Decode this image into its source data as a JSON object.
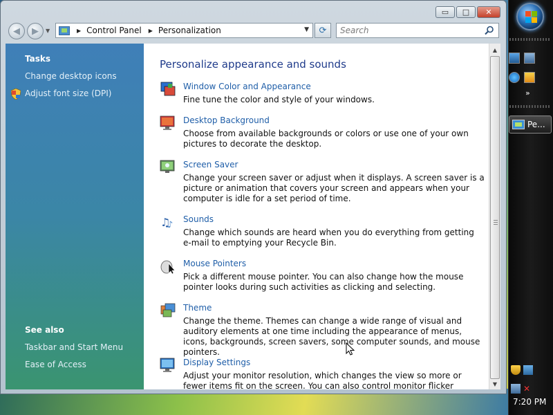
{
  "address": {
    "crumbs": [
      "Control Panel",
      "Personalization"
    ]
  },
  "search": {
    "placeholder": "Search"
  },
  "window_buttons": {
    "minimize": "▭",
    "maximize": "□",
    "close": "✕"
  },
  "left_pane": {
    "tasks_heading": "Tasks",
    "tasks": [
      "Change desktop icons",
      "Adjust font size (DPI)"
    ],
    "see_also_heading": "See also",
    "see_also": [
      "Taskbar and Start Menu",
      "Ease of Access"
    ]
  },
  "content": {
    "title": "Personalize appearance and sounds",
    "items": [
      {
        "label": "Window Color and Appearance",
        "desc": "Fine tune the color and style of your windows.",
        "icon": "window-color-icon"
      },
      {
        "label": "Desktop Background",
        "desc": "Choose from available backgrounds or colors or use one of your own pictures to decorate the desktop.",
        "icon": "desktop-background-icon"
      },
      {
        "label": "Screen Saver",
        "desc": "Change your screen saver or adjust when it displays. A screen saver is a picture or animation that covers your screen and appears when your computer is idle for a set period of time.",
        "icon": "screen-saver-icon"
      },
      {
        "label": "Sounds",
        "desc": "Change which sounds are heard when you do everything from getting e-mail to emptying your Recycle Bin.",
        "icon": "sounds-icon"
      },
      {
        "label": "Mouse Pointers",
        "desc": "Pick a different mouse pointer. You can also change how the mouse pointer looks during such activities as clicking and selecting.",
        "icon": "mouse-pointers-icon"
      },
      {
        "label": "Theme",
        "desc": "Change the theme. Themes can change a wide range of visual and auditory elements at one time including the appearance of menus, icons, backgrounds, screen savers, some computer sounds, and mouse pointers.",
        "icon": "theme-icon"
      },
      {
        "label": "Display Settings",
        "desc": "Adjust your monitor resolution, which changes the view so more or fewer items fit on the screen. You can also control monitor flicker (refresh rate).",
        "icon": "display-settings-icon"
      }
    ]
  },
  "taskbar": {
    "task_label": "Pe...",
    "clock": "7:20 PM"
  }
}
